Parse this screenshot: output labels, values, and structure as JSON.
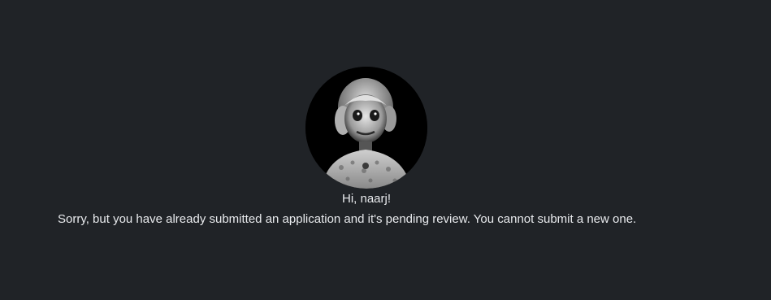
{
  "user": {
    "avatar_icon": "profile-avatar-doll-portrait",
    "greeting": "Hi, naarj!"
  },
  "notice": {
    "message": "Sorry, but you have already submitted an application and it's pending review. You cannot submit a new one."
  },
  "colors": {
    "background": "#202327",
    "text": "#e8eaed"
  }
}
